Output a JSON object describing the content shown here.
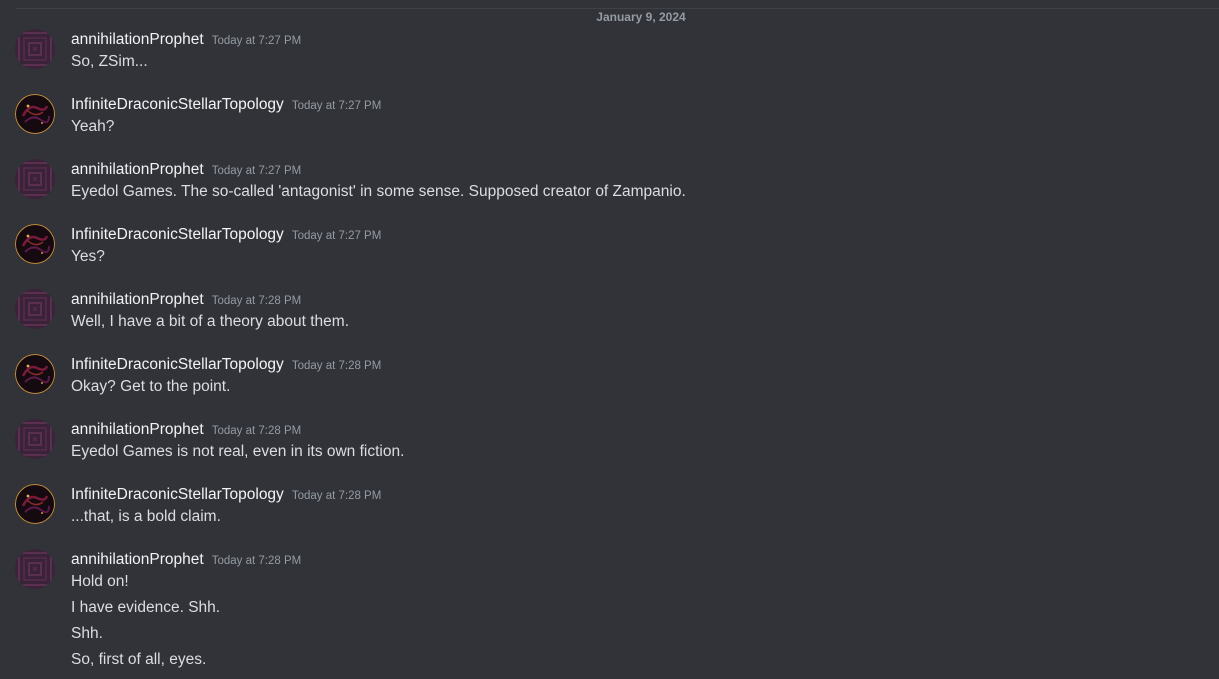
{
  "date_divider": "January 9, 2024",
  "messages": [
    {
      "author": "annihilationProphet",
      "avatar": "prophet",
      "time": "Today at 7:27 PM",
      "lines": [
        "So, ZSim..."
      ]
    },
    {
      "author": "InfiniteDraconicStellarTopology",
      "avatar": "dragon",
      "time": "Today at 7:27 PM",
      "lines": [
        "Yeah?"
      ]
    },
    {
      "author": "annihilationProphet",
      "avatar": "prophet",
      "time": "Today at 7:27 PM",
      "lines": [
        "Eyedol Games. The so-called 'antagonist' in some sense. Supposed creator of Zampanio."
      ]
    },
    {
      "author": "InfiniteDraconicStellarTopology",
      "avatar": "dragon",
      "time": "Today at 7:27 PM",
      "lines": [
        "Yes?"
      ]
    },
    {
      "author": "annihilationProphet",
      "avatar": "prophet",
      "time": "Today at 7:28 PM",
      "lines": [
        "Well, I have a bit of a theory about them."
      ]
    },
    {
      "author": "InfiniteDraconicStellarTopology",
      "avatar": "dragon",
      "time": "Today at 7:28 PM",
      "lines": [
        "Okay? Get to the point."
      ]
    },
    {
      "author": "annihilationProphet",
      "avatar": "prophet",
      "time": "Today at 7:28 PM",
      "lines": [
        "Eyedol Games is not real, even in its own fiction."
      ]
    },
    {
      "author": "InfiniteDraconicStellarTopology",
      "avatar": "dragon",
      "time": "Today at 7:28 PM",
      "lines": [
        "...that, is a bold claim."
      ]
    },
    {
      "author": "annihilationProphet",
      "avatar": "prophet",
      "time": "Today at 7:28 PM",
      "lines": [
        "Hold on!",
        "I have evidence. Shh.",
        "Shh.",
        "So, first of all, eyes."
      ]
    }
  ]
}
